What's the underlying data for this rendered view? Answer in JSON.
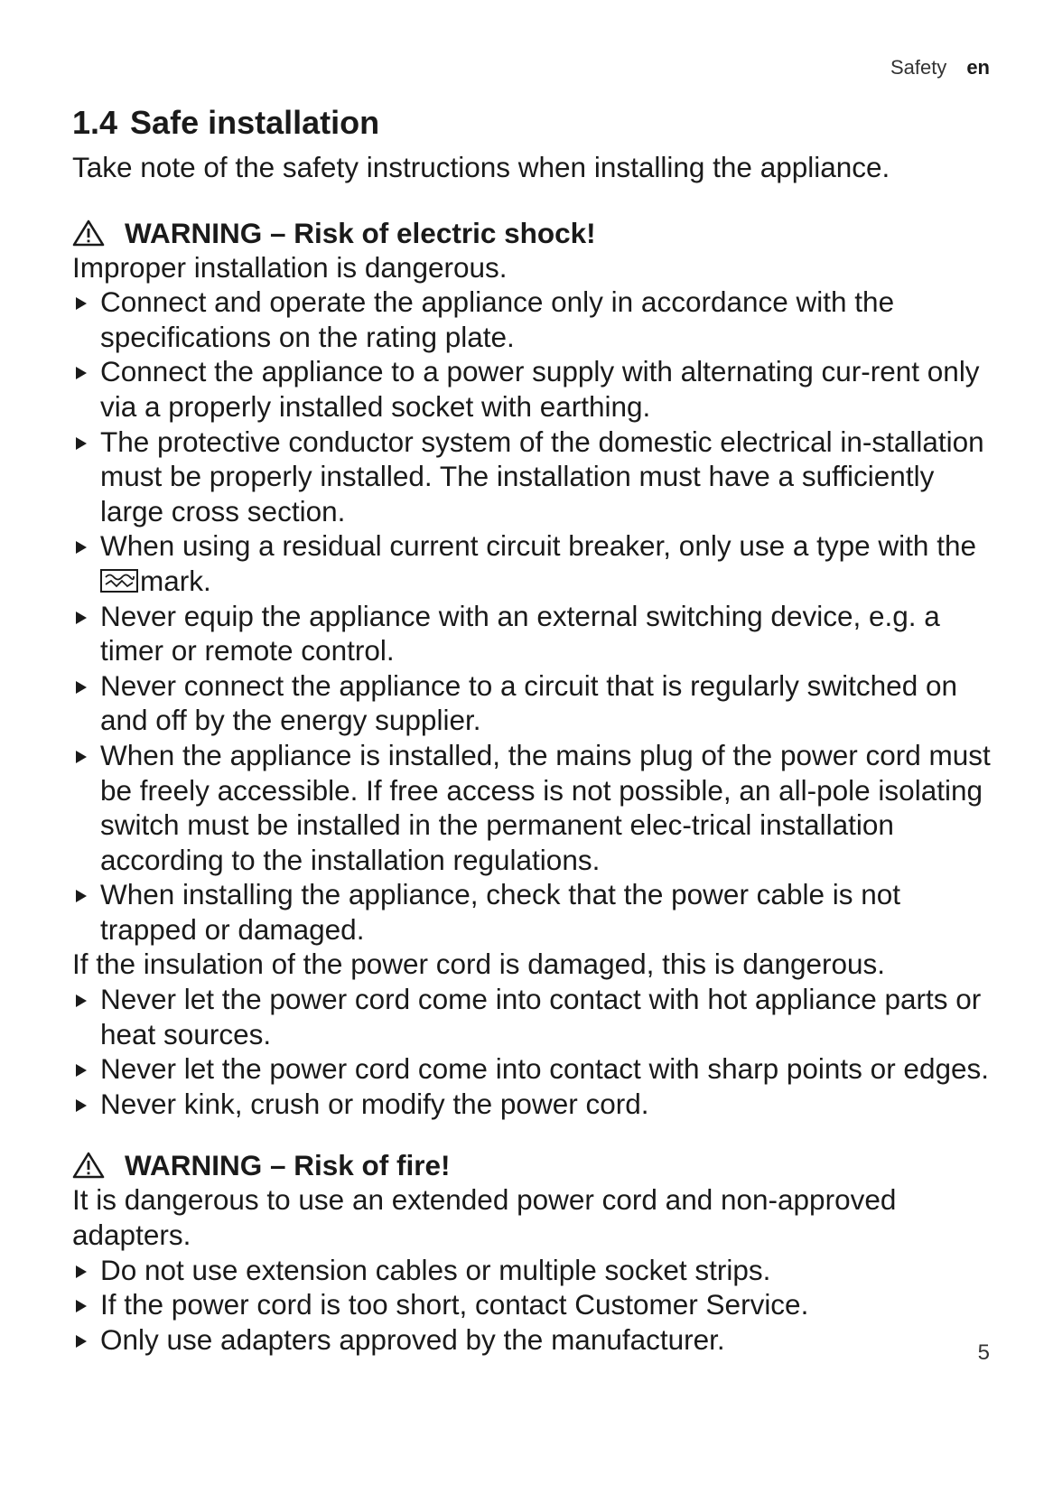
{
  "header": {
    "section": "Safety",
    "lang": "en"
  },
  "heading": {
    "number": "1.4",
    "title": "Safe installation"
  },
  "intro": "Take note of the safety instructions when installing the appliance.",
  "warning_shock": {
    "title": "WARNING – Risk of electric shock!",
    "lead": "Improper installation is dangerous.",
    "items": [
      "Connect and operate the appliance only in accordance with the specifications on the rating plate.",
      "Connect the appliance to a power supply with alternating cur-rent only via a properly installed socket with earthing.",
      "The protective conductor system of the domestic electrical in-stallation must be properly installed. The installation must have a sufficiently large cross section."
    ],
    "rcd_item": {
      "before": "When using a residual current circuit breaker, only use a type with the",
      "after": "mark."
    },
    "items2": [
      "Never equip the appliance with an external switching device, e.g. a timer or remote control.",
      "Never connect the appliance to a circuit that is regularly switched on and off by the energy supplier.",
      "When the appliance is installed, the mains plug of the power cord must be freely accessible. If free access is not possible, an all-pole isolating switch must be installed in the permanent elec-trical installation according to the installation regulations.",
      "When installing the appliance, check that the power cable is not trapped or damaged."
    ],
    "lead2": "If the insulation of the power cord is damaged, this is dangerous.",
    "items3": [
      "Never let the power cord come into contact with hot appliance parts or heat sources.",
      "Never let the power cord come into contact with sharp points or edges.",
      "Never kink, crush or modify the power cord."
    ]
  },
  "warning_fire": {
    "title": "WARNING – Risk of fire!",
    "lead": "It is dangerous to use an extended power cord and non-approved adapters.",
    "items": [
      "Do not use extension cables or multiple socket strips.",
      "If the power cord is too short, contact Customer Service.",
      "Only use adapters approved by the manufacturer."
    ]
  },
  "page_number": "5"
}
